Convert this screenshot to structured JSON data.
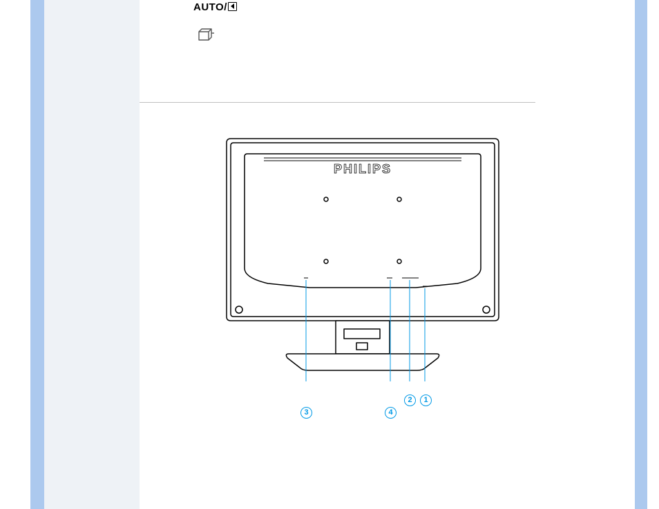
{
  "header": {
    "auto_label": "AUTO/",
    "lightframe_icon_name": "lightframe-icon"
  },
  "diagram": {
    "brand": "PHILIPS",
    "callouts": [
      "1",
      "2",
      "3",
      "4"
    ]
  },
  "colors": {
    "outer_strip": "#acc9ee",
    "sidebar": "#eef2f6",
    "callout": "#0099e6"
  }
}
